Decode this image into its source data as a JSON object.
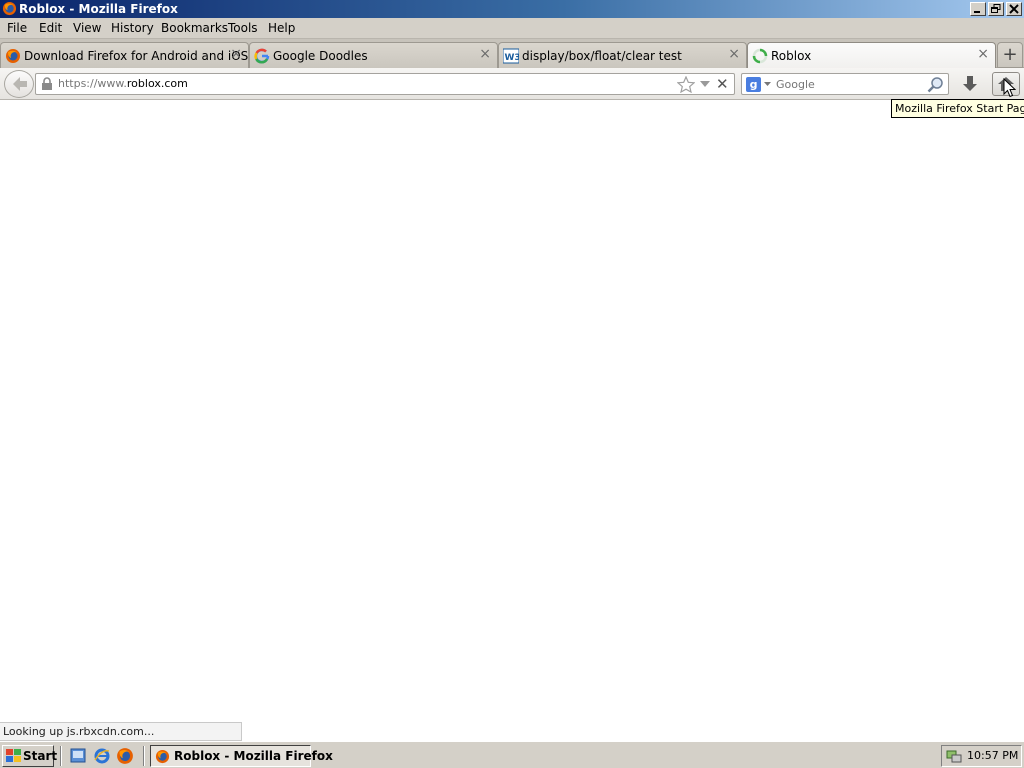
{
  "window": {
    "title": "Roblox - Mozilla Firefox"
  },
  "menu": [
    "File",
    "Edit",
    "View",
    "History",
    "Bookmarks",
    "Tools",
    "Help"
  ],
  "tabs": [
    {
      "label": "Download Firefox for Android and iOS",
      "icon": "firefox-icon",
      "close": "×"
    },
    {
      "label": "Google Doodles",
      "icon": "google-icon",
      "close": "×"
    },
    {
      "label": "display/box/float/clear test",
      "icon": "w3c-icon",
      "close": "×"
    },
    {
      "label": "Roblox",
      "icon": "loading-spinner-icon",
      "close": "×",
      "selected": true
    }
  ],
  "newtab_label": "+",
  "navbar": {
    "url_prefix": "https://www.",
    "url_domain": "roblox.com",
    "stop_label": "✕",
    "search_placeholder": "Google",
    "search_engine_letter": "g"
  },
  "tooltip": "Mozilla Firefox Start Page",
  "status": "Looking up js.rbxcdn.com...",
  "taskbar": {
    "start_label": "Start",
    "task_label": "Roblox - Mozilla Firefox",
    "clock": "10:57 PM"
  },
  "colors": {
    "titlebar_start": "#0a246a",
    "titlebar_end": "#a6caf0",
    "chrome_gray": "#d4d0c8",
    "tooltip_bg": "#ffffe1"
  }
}
